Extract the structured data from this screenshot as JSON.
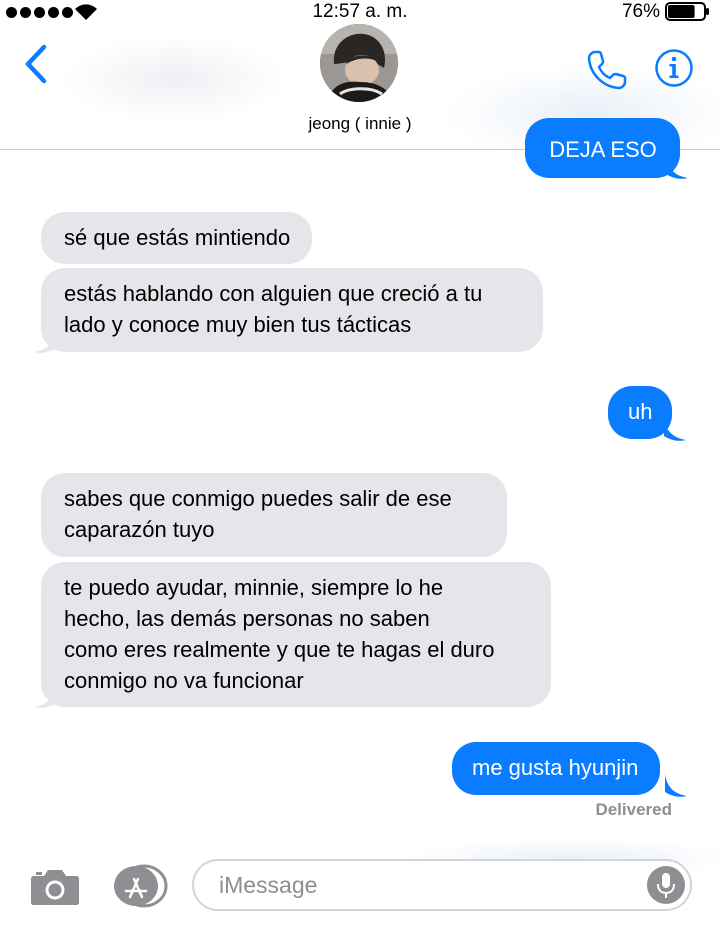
{
  "status_bar": {
    "time": "12:57 a. m.",
    "battery_percent": "76%",
    "battery_level": 0.76
  },
  "header": {
    "contact_name": "jeong ( innie )"
  },
  "conversation": {
    "messages": [
      {
        "direction": "outgoing",
        "text": "DEJA ESO"
      },
      {
        "direction": "incoming",
        "text": "sé que estás mintiendo"
      },
      {
        "direction": "incoming",
        "lines": [
          "estás hablando con alguien que creció a tu",
          "lado y conoce muy bien tus tácticas"
        ]
      },
      {
        "direction": "outgoing",
        "text": "uh"
      },
      {
        "direction": "incoming",
        "lines": [
          "sabes que conmigo puedes salir de ese",
          "caparazón tuyo"
        ]
      },
      {
        "direction": "incoming",
        "lines": [
          "te puedo ayudar, minnie, siempre lo he",
          "hecho, las demás personas no saben",
          "como eres realmente y que te hagas el duro",
          "conmigo no va funcionar"
        ]
      },
      {
        "direction": "outgoing",
        "text": "me gusta hyunjin"
      }
    ],
    "delivery_status": "Delivered"
  },
  "composer": {
    "placeholder": "iMessage"
  },
  "colors": {
    "accent": "#0a7cff",
    "incoming_bubble": "#e5e5ea",
    "outgoing_bubble": "#0a7cff",
    "secondary_text": "#8e8e93"
  },
  "icons": {
    "back": "chevron-left-icon",
    "call": "phone-icon",
    "info": "info-icon",
    "camera": "camera-icon",
    "apps": "app-store-icon",
    "mic": "microphone-icon"
  }
}
